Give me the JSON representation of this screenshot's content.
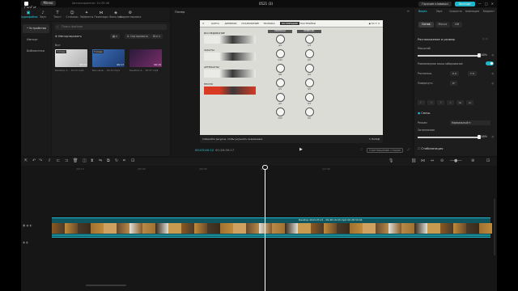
{
  "window": {
    "logo": "CapCut",
    "menu_label": "Меню",
    "autosave": "Автосохранено: 10:35:46",
    "project_title": "0521 (3)",
    "shortcuts_label": "Горячие клавиши",
    "export_label": "Экспорт",
    "controls": [
      "—",
      "□",
      "✕"
    ]
  },
  "toolbar": {
    "tools": [
      {
        "icon": "▣",
        "label": "Медиафайлы",
        "icon_name": "media-icon",
        "active": true
      },
      {
        "icon": "♪",
        "label": "Звук",
        "icon_name": "audio-icon"
      },
      {
        "icon": "T",
        "label": "Текст",
        "icon_name": "text-icon"
      },
      {
        "icon": "☺",
        "label": "Стикеры",
        "icon_name": "sticker-icon"
      },
      {
        "icon": "✦",
        "label": "Эффекты",
        "icon_name": "effects-icon"
      },
      {
        "icon": "⋈",
        "label": "Переходы",
        "icon_name": "transitions-icon"
      },
      {
        "icon": "◈",
        "label": "Фильтры",
        "icon_name": "filters-icon"
      },
      {
        "icon": "⚙",
        "label": "Корректировка",
        "icon_name": "adjust-icon"
      }
    ]
  },
  "left_nav": {
    "items": [
      {
        "label": "• Устройство",
        "selected": true
      },
      {
        "label": "Импорт"
      },
      {
        "label": "Библиотека"
      }
    ]
  },
  "media": {
    "search_placeholder": "Поиск файлов",
    "import_label": "Импортировать",
    "sort_label": "Сортировать",
    "filter_label": "Все",
    "all_label": "Все",
    "thumbs": [
      {
        "badge": "Готово",
        "duration": "00:23",
        "name": "Desktop 2… 19:23.mp4",
        "color_a": "#e8e8e8",
        "color_b": "#b0b0b0"
      },
      {
        "badge": "Готово",
        "duration": "00:17",
        "name": "Без назв… 19:13.mp4",
        "color_a": "#3a6fb8",
        "color_b": "#1d3a70"
      },
      {
        "badge": "",
        "duration": "00:15",
        "name": "Desktop 2… 18:37.mp4",
        "color_a": "#2b1b3a",
        "color_b": "#7a2d6a"
      }
    ]
  },
  "player": {
    "label": "Плеер",
    "menu": "≡",
    "timecode_current": "00:03:00:12",
    "timecode_total": "00:28:39:17",
    "play_icon": "▶",
    "controls_right": [
      "⛶",
      "Соотношение сторон",
      "⤢"
    ],
    "game": {
      "tabs": [
        "КАРТА",
        "ДНЕВНИК",
        "СНАРЯЖЕНИЕ",
        "ТЕХНИКА",
        "КОЛЛЕКЦИИ",
        "НАСТРОЙКИ"
      ],
      "active_tab": 4,
      "resources": "◆ 53  ✦ 2",
      "categories": [
        {
          "label": "ИССЛЕДОВАНИЕ",
          "color": "#eaeae6"
        },
        {
          "label": "ЗАКАТЫ",
          "color": "#eaeae6"
        },
        {
          "label": "АРТЕФАКТЫ",
          "color": "#eaeae6"
        },
        {
          "label": "ПЕСНИ",
          "color": "#d83a24"
        }
      ],
      "columns": [
        {
          "header": "ПРИПАСЫ",
          "values": [
            "0/1",
            "0/14",
            "0/8",
            "0/1",
            "0/2",
            "2/15"
          ]
        },
        {
          "header": "РЕМЕСЛО",
          "values": [
            "1/3",
            "0/3",
            "0/1",
            "0/2",
            "0/4",
            "0/2"
          ]
        }
      ],
      "hint": "Собирайте ресурсы, чтобы улучшить снаряжение.",
      "back": "НАЗАД"
    }
  },
  "properties": {
    "tabs": [
      {
        "label": "Видео",
        "active": true
      },
      {
        "label": "Звук"
      },
      {
        "label": "Скорость"
      },
      {
        "label": "Анимация"
      },
      {
        "label": "Коррект"
      }
    ],
    "subtabs": [
      {
        "label": "Основ",
        "active": true
      },
      {
        "label": "Маска"
      },
      {
        "label": "ИИ"
      }
    ],
    "section_position": "Расположение и размер",
    "scale_label": "Масштаб",
    "scale_value": "100%",
    "scale_fraction": 1.0,
    "uniform_label": "Равномерное масштабирование",
    "position_label": "Располож.",
    "pos_x": "0",
    "pos_y": "0",
    "rotate_label": "Повернуть",
    "rotate_value": "0°",
    "blend_section": "Смеш.",
    "mode_label": "Режим",
    "mode_value": "Нормальный",
    "opacity_label": "Затемнение",
    "opacity_value": "100%",
    "opacity_fraction": 1.0,
    "stabilize_label": "Стабилизация"
  },
  "timeline": {
    "ticks": [
      "|00:15",
      "|02:40",
      "|05:00",
      "|10:05",
      "|12:30"
    ],
    "clip_label": "Desktop 2024.05.21 - 09.48.19.03.mp4   00:28:39:04",
    "track_main_icons": "▣ ◉ ◐",
    "track_audio_icons": "◉ ◐"
  }
}
